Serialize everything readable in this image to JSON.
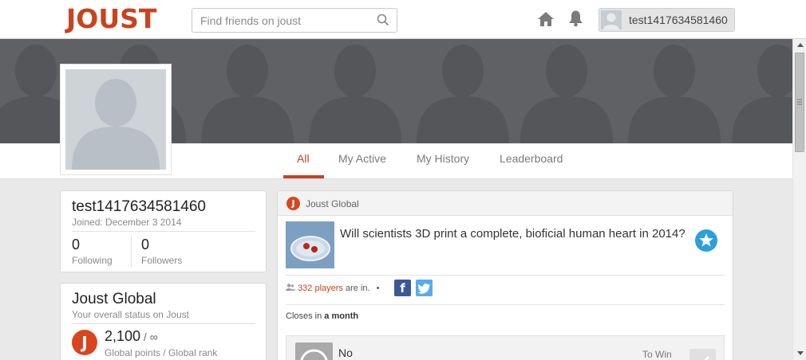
{
  "header": {
    "logo": "JOUST",
    "search_placeholder": "Find friends on joust",
    "username": "test1417634581460"
  },
  "tabs": [
    {
      "label": "All",
      "active": true
    },
    {
      "label": "My Active",
      "active": false
    },
    {
      "label": "My History",
      "active": false
    },
    {
      "label": "Leaderboard",
      "active": false
    }
  ],
  "profile_card": {
    "username": "test1417634581460",
    "joined": "Joined: December 3 2014",
    "following_count": "0",
    "following_label": "Following",
    "followers_count": "0",
    "followers_label": "Followers"
  },
  "global_card": {
    "title": "Joust Global",
    "subtitle": "Your overall status on Joust",
    "badge_letter": "J",
    "points": "2,100",
    "rank": "∞",
    "points_label": "Global points / Global rank"
  },
  "feed": {
    "source_icon": "J",
    "source": "Joust Global",
    "question": "Will scientists 3D print a complete, bioficial human heart in 2014?",
    "players_count": "332 players",
    "players_suffix": " are in.",
    "bullet": "•",
    "facebook_glyph": "f",
    "closes_prefix": "Closes in ",
    "closes_value": "a month",
    "answer_label": "No",
    "to_win_label": "To Win"
  },
  "colors": {
    "brand": "#c8431f",
    "facebook": "#3b5998",
    "twitter": "#55acee",
    "star": "#2b9fe0"
  }
}
